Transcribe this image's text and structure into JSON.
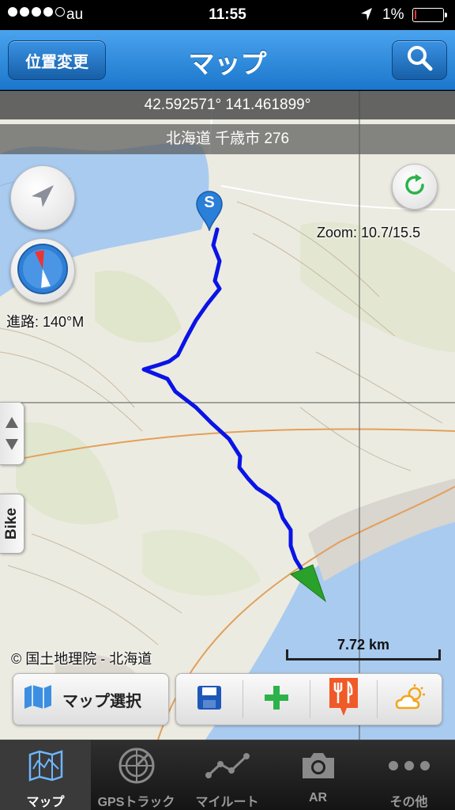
{
  "status_bar": {
    "carrier": "au",
    "time": "11:55",
    "battery_pct": "1%"
  },
  "nav": {
    "left_button": "位置変更",
    "title": "マップ",
    "right_icon": "search-icon"
  },
  "location": {
    "coordinates": "42.592571° 141.461899°",
    "address": "北海道 千歳市 276"
  },
  "map": {
    "zoom_text": "Zoom: 10.7/15.5",
    "heading_text": "進路: 140°M",
    "start_marker_label": "S",
    "side_tab_label": "Bike",
    "attribution": "© 国土地理院 - 北海道",
    "scale_label": "7.72 km",
    "colors": {
      "route": "#0a14e6",
      "water": "#a9cbf0",
      "land": "#ecebe1",
      "end_arrow": "#2aa12a"
    }
  },
  "actions": {
    "map_select_label": "マップ選択",
    "icons": [
      "save-icon",
      "add-icon",
      "restaurant-icon",
      "weather-icon"
    ]
  },
  "tabs": [
    {
      "label": "マップ",
      "icon": "map-icon",
      "active": true
    },
    {
      "label": "GPSトラック",
      "icon": "radar-icon",
      "active": false
    },
    {
      "label": "マイルート",
      "icon": "route-icon",
      "active": false
    },
    {
      "label": "AR",
      "icon": "camera-icon",
      "active": false
    },
    {
      "label": "その他",
      "icon": "more-icon",
      "active": false
    }
  ]
}
